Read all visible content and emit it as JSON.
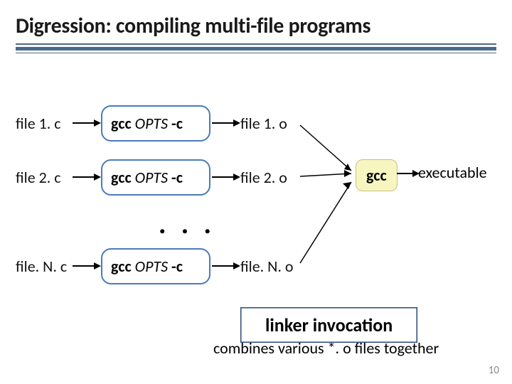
{
  "title": "Digression: compiling multi-file programs",
  "rows": [
    {
      "src": "file 1. c",
      "out": "file 1. o"
    },
    {
      "src": "file 2. c",
      "out": "file 2. o"
    },
    {
      "src": "file. N. c",
      "out": "file. N. o"
    }
  ],
  "cmd": {
    "gcc": "gcc",
    "opts": "OPTS",
    "flag": "-c"
  },
  "ellipsis": ". . .",
  "link": {
    "gcc": "gcc",
    "output": "executable"
  },
  "linker_box": "linker invocation",
  "linker_sub": "combines various *. o files together",
  "page_number": "10"
}
